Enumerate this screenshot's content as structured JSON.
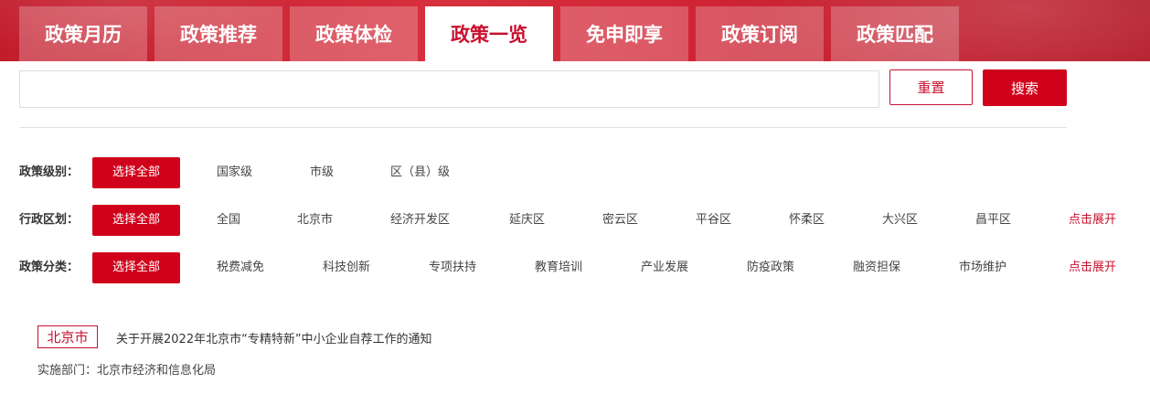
{
  "tabs": [
    {
      "label": "政策月历"
    },
    {
      "label": "政策推荐"
    },
    {
      "label": "政策体检"
    },
    {
      "label": "政策一览"
    },
    {
      "label": "免申即享"
    },
    {
      "label": "政策订阅"
    },
    {
      "label": "政策匹配"
    }
  ],
  "active_tab": "政策一览",
  "search": {
    "value": "",
    "placeholder": "",
    "reset_label": "重置",
    "search_label": "搜索"
  },
  "filters": {
    "level": {
      "label": "政策级别：",
      "options": [
        "选择全部",
        "国家级",
        "市级",
        "区（县）级"
      ]
    },
    "region": {
      "label": "行政区划：",
      "options": [
        "选择全部",
        "全国",
        "北京市",
        "经济开发区",
        "延庆区",
        "密云区",
        "平谷区",
        "怀柔区",
        "大兴区",
        "昌平区"
      ],
      "expand_label": "点击展开"
    },
    "category": {
      "label": "政策分类：",
      "options": [
        "选择全部",
        "税费减免",
        "科技创新",
        "专项扶持",
        "教育培训",
        "产业发展",
        "防疫政策",
        "融资担保",
        "市场维护"
      ],
      "expand_label": "点击展开"
    }
  },
  "results": [
    {
      "tag": "北京市",
      "title": "关于开展2022年北京市“专精特新”中小企业自荐工作的通知",
      "dept_label": "实施部门：",
      "dept": "北京市经济和信息化局"
    }
  ],
  "colors": {
    "brand_red": "#d0021b",
    "text": "#333333",
    "border": "#dcdcdc"
  }
}
